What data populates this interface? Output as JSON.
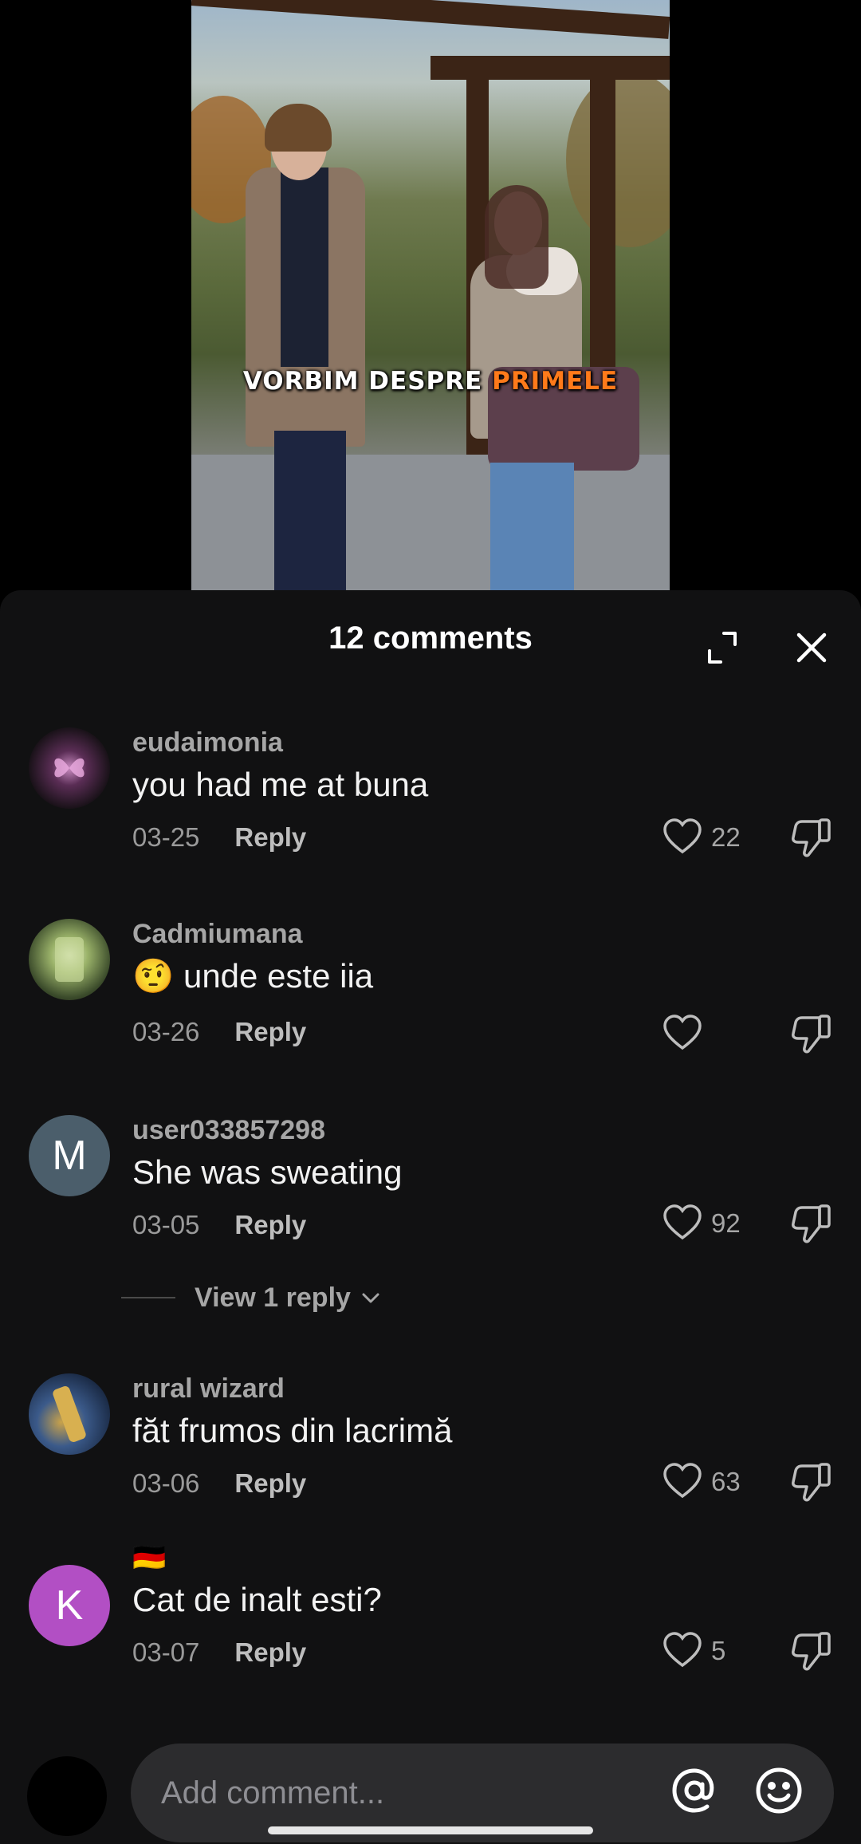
{
  "video": {
    "caption_white": "VORBIM DESPRE",
    "caption_orange": "PRIMELE",
    "colors": {
      "caption_highlight": "#ff7a1a"
    }
  },
  "sheet": {
    "title": "12 comments"
  },
  "comments": [
    {
      "username": "eudaimonia",
      "text": "you had me at buna",
      "date": "03-25",
      "reply_label": "Reply",
      "likes": "22",
      "avatar_color": "#2a1a2a"
    },
    {
      "username": "Cadmiumana",
      "text": "🤨 unde este iia",
      "date": "03-26",
      "reply_label": "Reply",
      "likes": "",
      "avatar_color": "#4a5a3a"
    },
    {
      "username": "user033857298",
      "text": "She was sweating",
      "date": "03-05",
      "reply_label": "Reply",
      "likes": "92",
      "avatar_letter": "M",
      "avatar_color": "#4b5e6b"
    },
    {
      "username": "rural wizard",
      "text": "făt frumos din lacrimă",
      "date": "03-06",
      "reply_label": "Reply",
      "likes": "63",
      "avatar_color": "#2d3b55"
    },
    {
      "username": "🇩🇪",
      "text": "Cat de inalt esti?",
      "date": "03-07",
      "reply_label": "Reply",
      "likes": "5",
      "avatar_letter": "K",
      "avatar_color": "#b24fc4"
    }
  ],
  "view_replies": {
    "label": "View 1 reply"
  },
  "composer": {
    "placeholder": "Add comment..."
  },
  "icons": {
    "expand": "expand-icon",
    "close": "close-icon",
    "like": "heart-icon",
    "dislike": "thumbs-down-icon",
    "mention": "at-sign-icon",
    "emoji": "smiley-icon",
    "chevron": "chevron-down-icon"
  }
}
